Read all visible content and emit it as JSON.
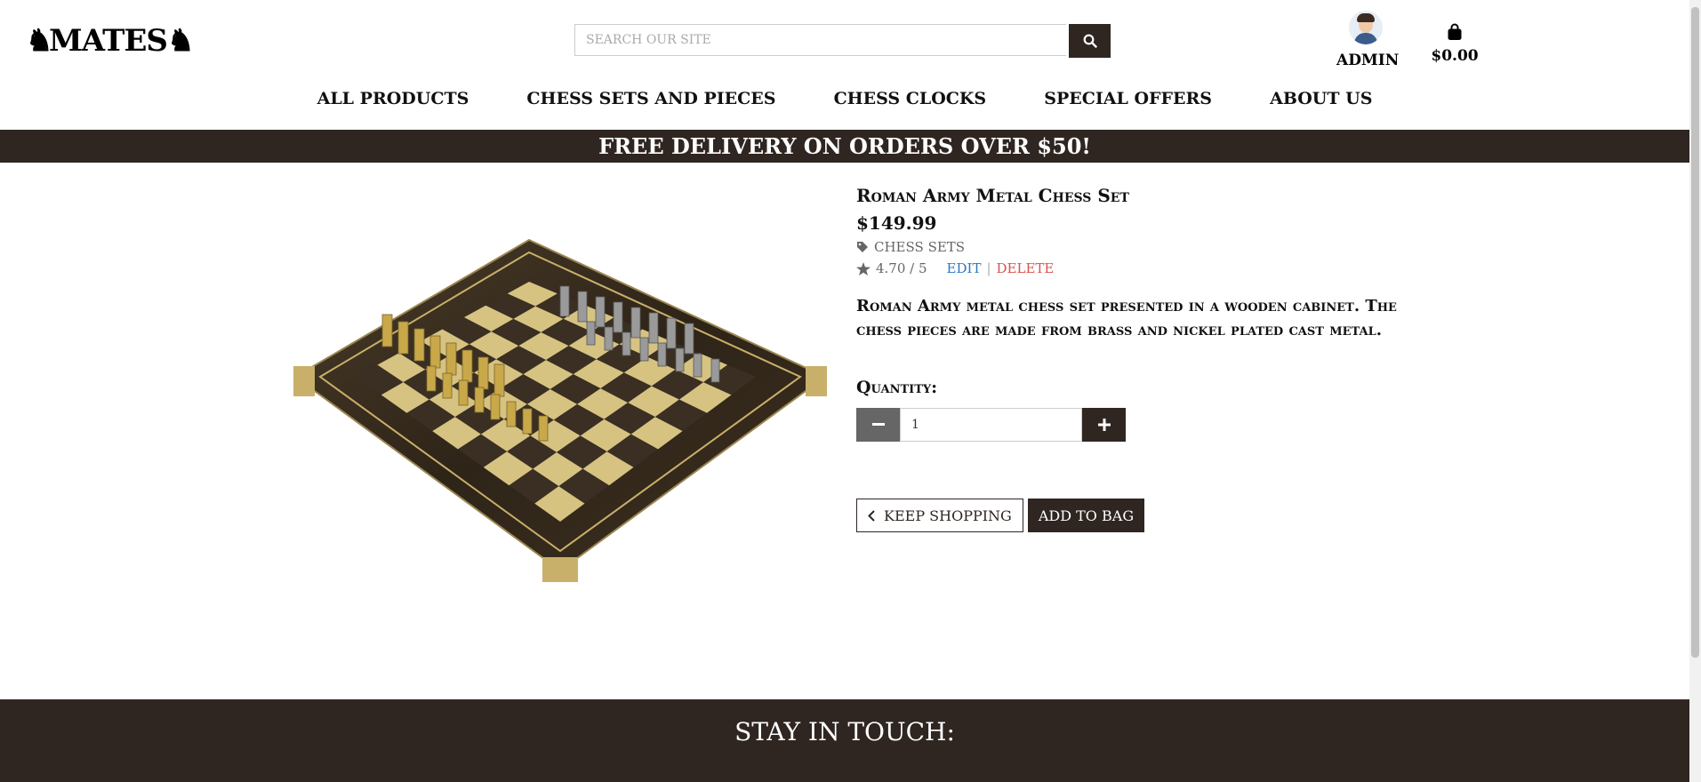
{
  "brand": {
    "logo_text": "MATES",
    "logo_icon_left": "♞",
    "logo_icon_right": "♞"
  },
  "search": {
    "placeholder": "SEARCH OUR SITE",
    "value": "",
    "icon": "search-icon"
  },
  "account": {
    "label": "ADMIN",
    "icon": "avatar"
  },
  "bag": {
    "total": "$0.00",
    "icon": "shopping-bag-icon"
  },
  "nav": {
    "items": [
      "ALL PRODUCTS",
      "CHESS SETS AND PIECES",
      "CHESS CLOCKS",
      "SPECIAL OFFERS",
      "ABOUT US"
    ]
  },
  "banner": {
    "text": "FREE DELIVERY ON ORDERS OVER $50!"
  },
  "product": {
    "title": "Roman Army Metal Chess Set",
    "price": "$149.99",
    "category": "Chess Sets",
    "rating": "4.70 / 5",
    "edit_label": "Edit",
    "separator": "|",
    "delete_label": "Delete",
    "description": "Roman Army metal chess set presented in a wooden cabinet. The chess pieces are made from brass and nickel plated cast metal.",
    "quantity_label": "Quantity:",
    "quantity_value": "1",
    "keep_shopping_label": "Keep Shopping",
    "add_to_bag_label": "Add to Bag",
    "image_alt": "Roman Army Metal Chess Set"
  },
  "footer": {
    "heading": "STAY IN TOUCH:"
  },
  "colors": {
    "dark": "#2f2622",
    "edit": "#2a78c5",
    "delete": "#d9534f"
  }
}
